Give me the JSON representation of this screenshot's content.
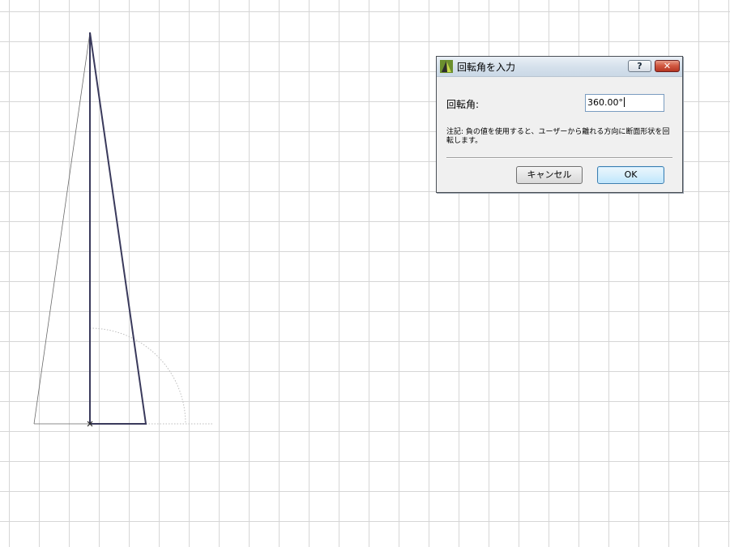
{
  "dialog": {
    "title": "回転角を入力",
    "help_label": "?",
    "close_label": "✕",
    "angle_label": "回転角:",
    "angle_value": "360.00°",
    "note": "注記: 負の値を使用すると、ユーザーから離れる方向に断面形状を回転します。",
    "cancel_label": "キャンセル",
    "ok_label": "OK"
  },
  "icons": {
    "app_icon": "archicad-app-icon",
    "help_icon": "help-icon",
    "close_icon": "close-icon",
    "origin_marker": "x-marker-icon"
  },
  "colors": {
    "grid": "#d6d6d6",
    "profile_line": "#3a3a5c",
    "guide_line": "#bdbdbd",
    "close_button": "#c94b35",
    "ok_button_border": "#3c7fb1"
  }
}
